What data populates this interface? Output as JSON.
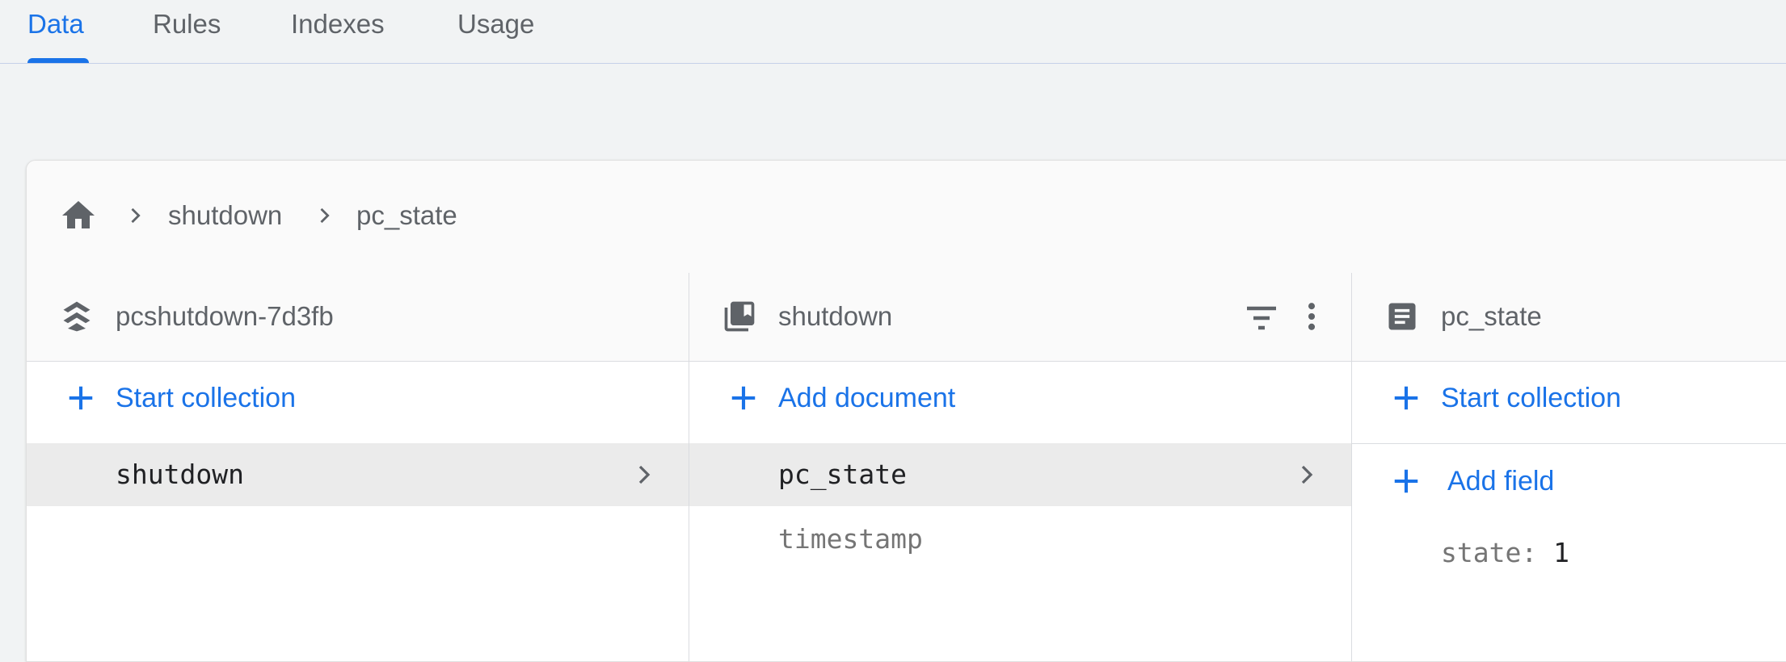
{
  "tabs": [
    {
      "label": "Data",
      "active": true
    },
    {
      "label": "Rules",
      "active": false
    },
    {
      "label": "Indexes",
      "active": false
    },
    {
      "label": "Usage",
      "active": false
    }
  ],
  "breadcrumb": {
    "home_icon": "home-icon",
    "items": [
      "shutdown",
      "pc_state"
    ]
  },
  "columns": {
    "project": {
      "title": "pcshutdown-7d3fb",
      "icon": "firestore-stack-icon",
      "action_label": "Start collection",
      "items": [
        {
          "label": "shutdown",
          "selected": true
        }
      ]
    },
    "collection": {
      "title": "shutdown",
      "icon": "collection-icon",
      "header_icons": [
        "filter-icon",
        "more-vert-icon"
      ],
      "action_label": "Add document",
      "items": [
        {
          "label": "pc_state",
          "selected": true
        },
        {
          "label": "timestamp",
          "selected": false
        }
      ]
    },
    "document": {
      "title": "pc_state",
      "icon": "document-icon",
      "action_label": "Start collection",
      "add_field_label": "Add field",
      "fields": [
        {
          "key": "state:",
          "value": "1"
        }
      ]
    }
  },
  "colors": {
    "accent": "#1a73e8",
    "text_muted": "#5f6368",
    "selected_row": "#ebebeb"
  }
}
